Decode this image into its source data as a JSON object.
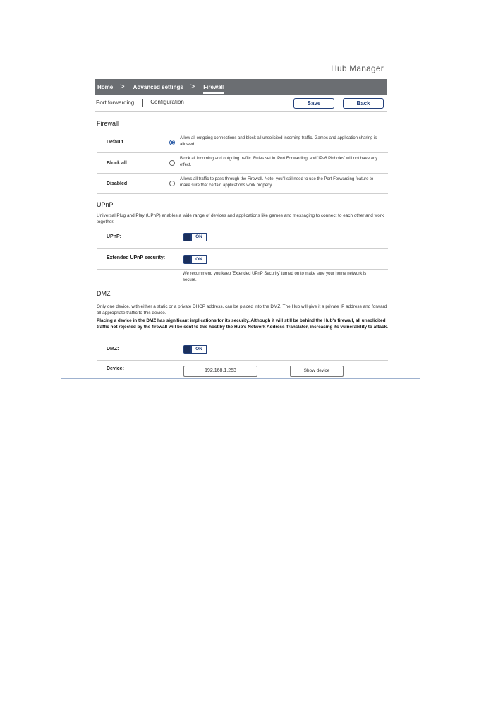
{
  "app": {
    "brand": "Hub Manager"
  },
  "breadcrumb": {
    "items": [
      "Home",
      "Advanced settings",
      "Firewall"
    ],
    "separator": ">"
  },
  "tabs": {
    "port_forwarding": "Port forwarding",
    "configuration": "Configuration"
  },
  "toolbar": {
    "save_label": "Save",
    "back_label": "Back"
  },
  "firewall": {
    "heading": "Firewall",
    "options": [
      {
        "label": "Default",
        "selected": true,
        "description": "Allow all outgoing connections and block all unsolicited incoming traffic. Games and application sharing is allowed."
      },
      {
        "label": "Block all",
        "selected": false,
        "description": "Block all incoming and outgoing traffic. Rules set in 'Port Forwarding' and 'IPv6 Pinholes' will not have any effect."
      },
      {
        "label": "Disabled",
        "selected": false,
        "description": "Allows all traffic to pass through the Firewall. Note: you'll still need to use the Port Forwarding feature to make sure that certain applications work properly."
      }
    ]
  },
  "upnp": {
    "heading": "UPnP",
    "description": "Universal Plug and Play (UPnP) enables a wide range of devices and applications like games and messaging to connect to each other and work together.",
    "upnp_label": "UPnP:",
    "upnp_state": "ON",
    "extended_label": "Extended UPnP security:",
    "extended_state": "ON",
    "recommendation": "We recommend you keep 'Extended UPnP Security' turned on to make sure your home network is secure."
  },
  "dmz": {
    "heading": "DMZ",
    "description": "Only one device, with either a static or a private DHCP address, can be placed into the DMZ. The Hub will give it a private IP address and forward all appropriate traffic to this device.",
    "warning": "Placing a device in the DMZ has significant implications for its security. Although it will still be behind the Hub's firewall, all unsolicited traffic not rejected by the firewall will be sent to this host by the Hub's Network Address Translator, increasing its vulnerability to attack.",
    "dmz_label": "DMZ:",
    "dmz_state": "ON",
    "device_label": "Device:",
    "device_value": "192.168.1.253",
    "show_device_label": "Show device"
  },
  "colors": {
    "accent": "#23407a",
    "header_bar": "#6b6e72"
  }
}
